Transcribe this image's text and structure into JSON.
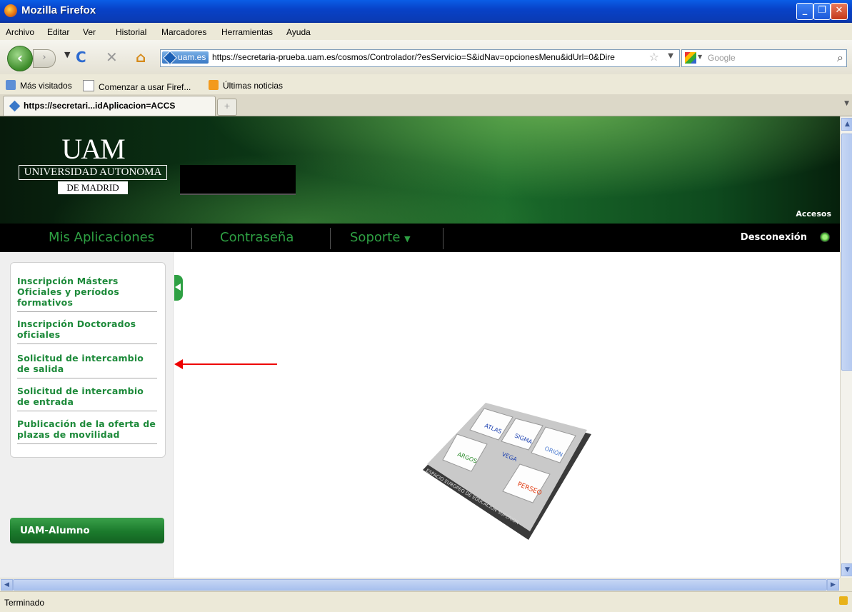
{
  "window": {
    "title": "Mozilla Firefox"
  },
  "menu": [
    "Archivo",
    "Editar",
    "Ver",
    "Historial",
    "Marcadores",
    "Herramientas",
    "Ayuda"
  ],
  "nav": {
    "identity_label": "uam.es",
    "url": "https://secretaria-prueba.uam.es/cosmos/Controlador/?esServicio=S&idNav=opcionesMenu&idUrl=0&Dire",
    "search_placeholder": "Google"
  },
  "bookmarks": [
    "Más visitados",
    "Comenzar a usar Firef...",
    "Últimas noticias"
  ],
  "tab": {
    "label": "https://secretari...idAplicacion=ACCS",
    "new_tab": "+"
  },
  "site": {
    "logo_uam": "UAM",
    "logo_line1": "UNIVERSIDAD AUTONOMA",
    "logo_line2": "DE MADRID",
    "accesos": "Accesos",
    "nav_items": [
      "Mis Aplicaciones",
      "Contraseña",
      "Soporte"
    ],
    "logout": "Desconexión"
  },
  "sidebar": {
    "items": [
      "Inscripción Másters Oficiales y períodos formativos",
      "Inscripción Doctorados oficiales",
      "Solicitud de intercambio de salida",
      "Solicitud de intercambio de entrada",
      "Publicación de la oferta de plazas de movilidad"
    ],
    "alumno_button": "UAM-Alumno"
  },
  "board": {
    "tiles": [
      "ATLAS",
      "SIGMA",
      "ORIÓN",
      "VEGA",
      "ARGOS",
      "PERSEO"
    ],
    "base_text": "ESPACIO EUROPEO DE EDUCACIÓN SUPERIOR"
  },
  "status": {
    "text": "Terminado"
  }
}
